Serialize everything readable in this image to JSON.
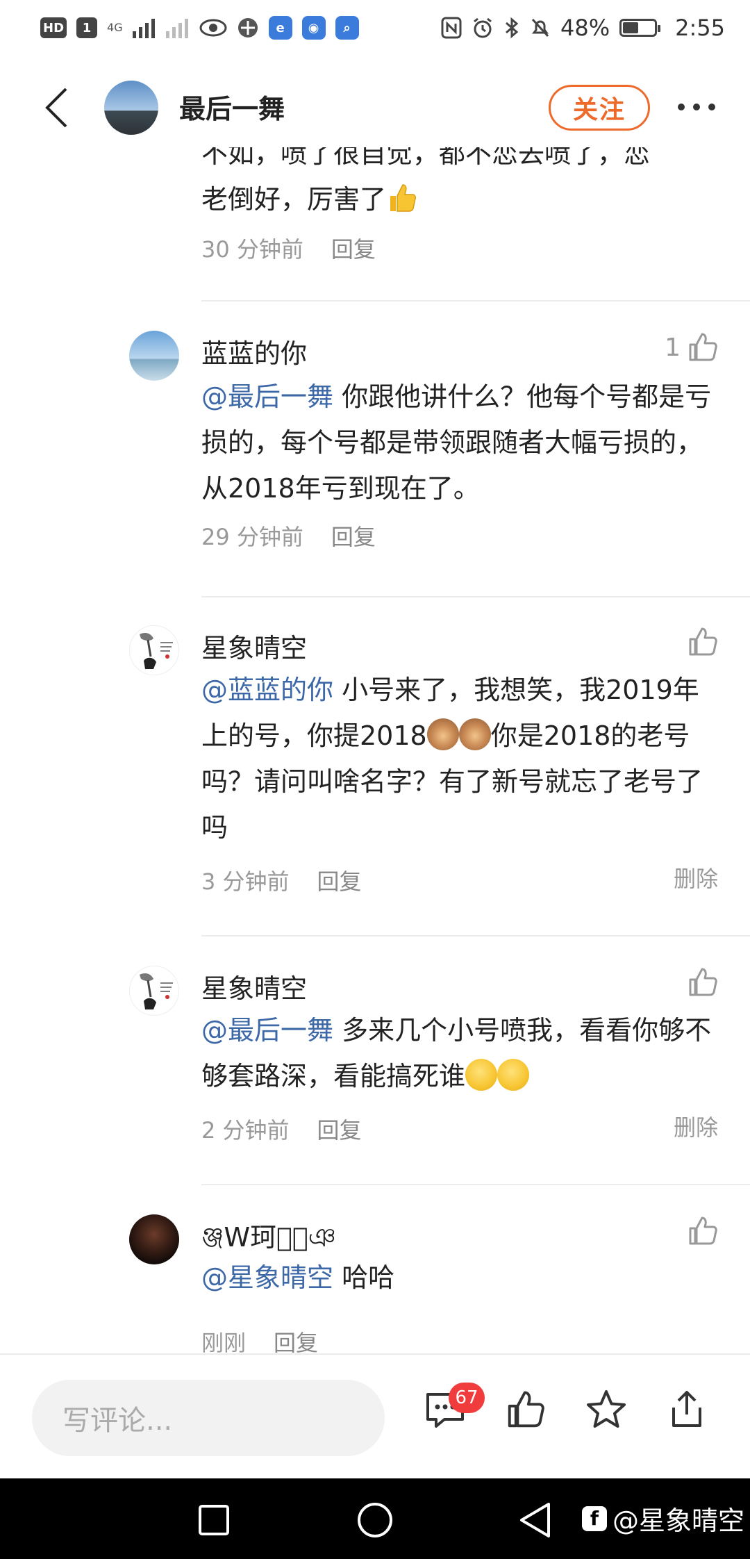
{
  "status_bar": {
    "hd": "HD",
    "sim": "1",
    "network": "4G",
    "battery_percent_text": "48%",
    "battery_level": 0.48,
    "time": "2:55"
  },
  "header": {
    "title": "最后一舞",
    "follow_label": "关注"
  },
  "partial_comment": {
    "cut_line": "不如，喷了很自觉，都不恋去喷了，恋",
    "line2": "老倒好，厉害了",
    "time": "30 分钟前",
    "reply": "回复"
  },
  "comments": [
    {
      "name": "蓝蓝的你",
      "likes": "1",
      "mention": "@最后一舞",
      "text": " 你跟他讲什么？他每个号都是亏损的，每个号都是带领跟随者大幅亏损的，从2018年亏到现在了。",
      "time": "29 分钟前",
      "reply": "回复"
    },
    {
      "name": "星象晴空",
      "mention": "@蓝蓝的你",
      "text_a": " 小号来了，我想笑，我2019年上的号，你提2018",
      "text_b": "你是2018的老号吗？请问叫啥名字？有了新号就忘了老号了吗",
      "time": "3 分钟前",
      "reply": "回复",
      "delete": "删除"
    },
    {
      "name": "星象晴空",
      "mention": "@最后一舞",
      "text": " 多来几个小号喷我，看看你够不够套路深，看能搞死谁",
      "time": "2 分钟前",
      "reply": "回复",
      "delete": "删除"
    },
    {
      "name": "ঞ্জW珂ৣ৾ঞ",
      "mention": "@星象晴空",
      "text": " 哈哈",
      "time": "刚刚",
      "reply": "回复"
    }
  ],
  "bottom_bar": {
    "input_placeholder": "写评论...",
    "comment_count": "67"
  },
  "watermark": {
    "text": "@星象晴空"
  }
}
